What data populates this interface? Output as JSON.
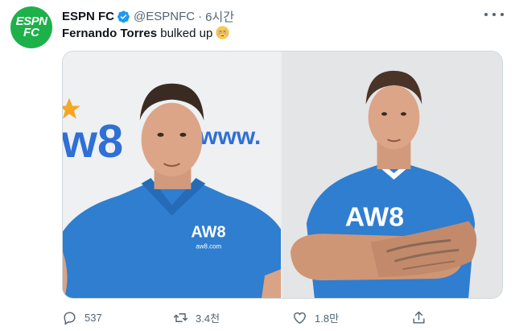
{
  "account": {
    "avatar_line1": "ESPN",
    "avatar_line2": "FC",
    "name": "ESPN FC",
    "handle": "@ESPNFC",
    "separator": "·",
    "time": "6시간"
  },
  "tweet": {
    "mention": "Fernando Torres",
    "text": " bulked up"
  },
  "media": {
    "left_photo_sign_text": "www.",
    "left_photo_logo": "w8",
    "left_shirt_logo": "AW8",
    "left_shirt_url": "aw8.com",
    "right_shirt_logo": "AW8"
  },
  "actions": {
    "reply_count": "537",
    "retweet_count": "3.4천",
    "like_count": "1.8만"
  },
  "colors": {
    "brand_green": "#1db14a",
    "verified_blue": "#1d9bf0",
    "jersey_blue": "#2f7ed0",
    "muted_text": "#536471"
  }
}
